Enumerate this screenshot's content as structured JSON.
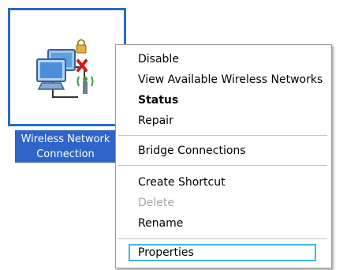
{
  "desktop_icon": {
    "label_line1": "Wireless Network",
    "label_line2": "Connection",
    "icon": "wireless-network-connection-icon"
  },
  "context_menu": {
    "items": [
      {
        "label": "Disable",
        "state": "normal"
      },
      {
        "label": "View Available Wireless Networks",
        "state": "normal"
      },
      {
        "label": "Status",
        "state": "default"
      },
      {
        "label": "Repair",
        "state": "normal"
      },
      {
        "label": "Bridge Connections",
        "state": "normal"
      },
      {
        "label": "Create Shortcut",
        "state": "normal"
      },
      {
        "label": "Delete",
        "state": "disabled"
      },
      {
        "label": "Rename",
        "state": "normal"
      },
      {
        "label": "Properties",
        "state": "highlighted"
      }
    ]
  },
  "colors": {
    "selection_blue": "#2f64c8",
    "highlight_border": "#42b6e6",
    "disabled_text": "#a8a8a8"
  }
}
